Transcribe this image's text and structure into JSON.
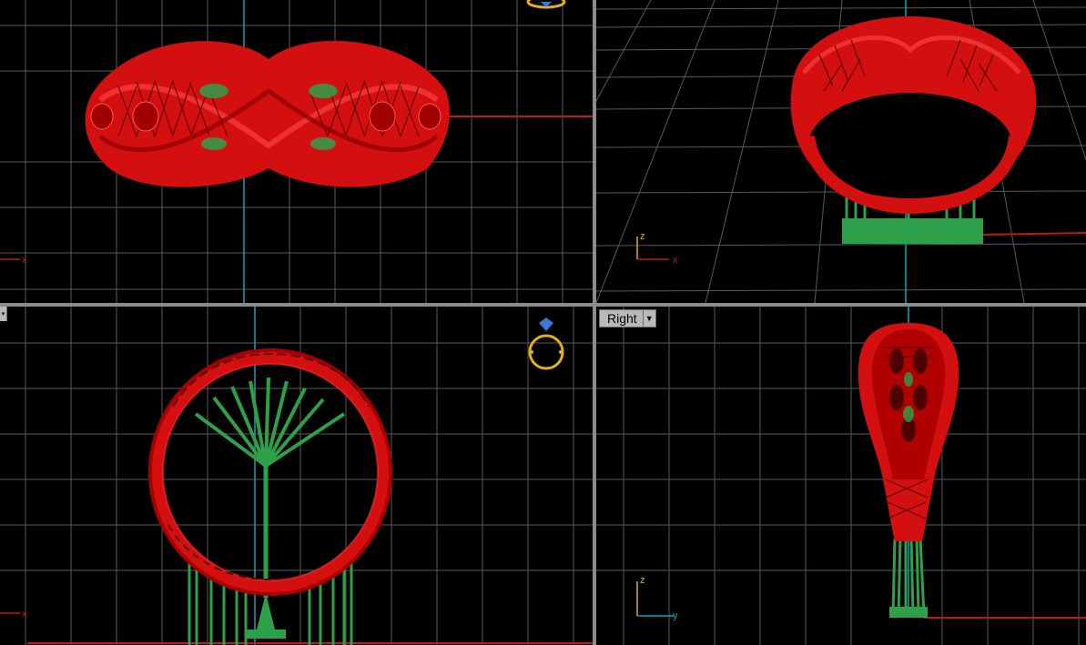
{
  "viewports": {
    "top": {
      "axis_labels": {
        "x": "x"
      }
    },
    "perspective": {
      "axis_labels": {
        "x": "x",
        "z": "z"
      }
    },
    "front": {
      "axis_labels": {
        "x": "x"
      }
    },
    "right": {
      "title": "Right",
      "axis_labels": {
        "z": "z",
        "y": "y"
      }
    }
  },
  "colors": {
    "background": "#000000",
    "grid": "#5a5a5a",
    "grid_major": "#8a8a8a",
    "model": "#e01010",
    "model_shade": "#9a0000",
    "support": "#2fa04a",
    "x_axis": "#c01818",
    "y_axis": "#17a2b8",
    "divider": "#8c8c8c",
    "ring_icon": "#e0b020",
    "gem_icon": "#3a78d8"
  },
  "icons": [
    "ring-icon",
    "dropdown-arrow-icon"
  ]
}
